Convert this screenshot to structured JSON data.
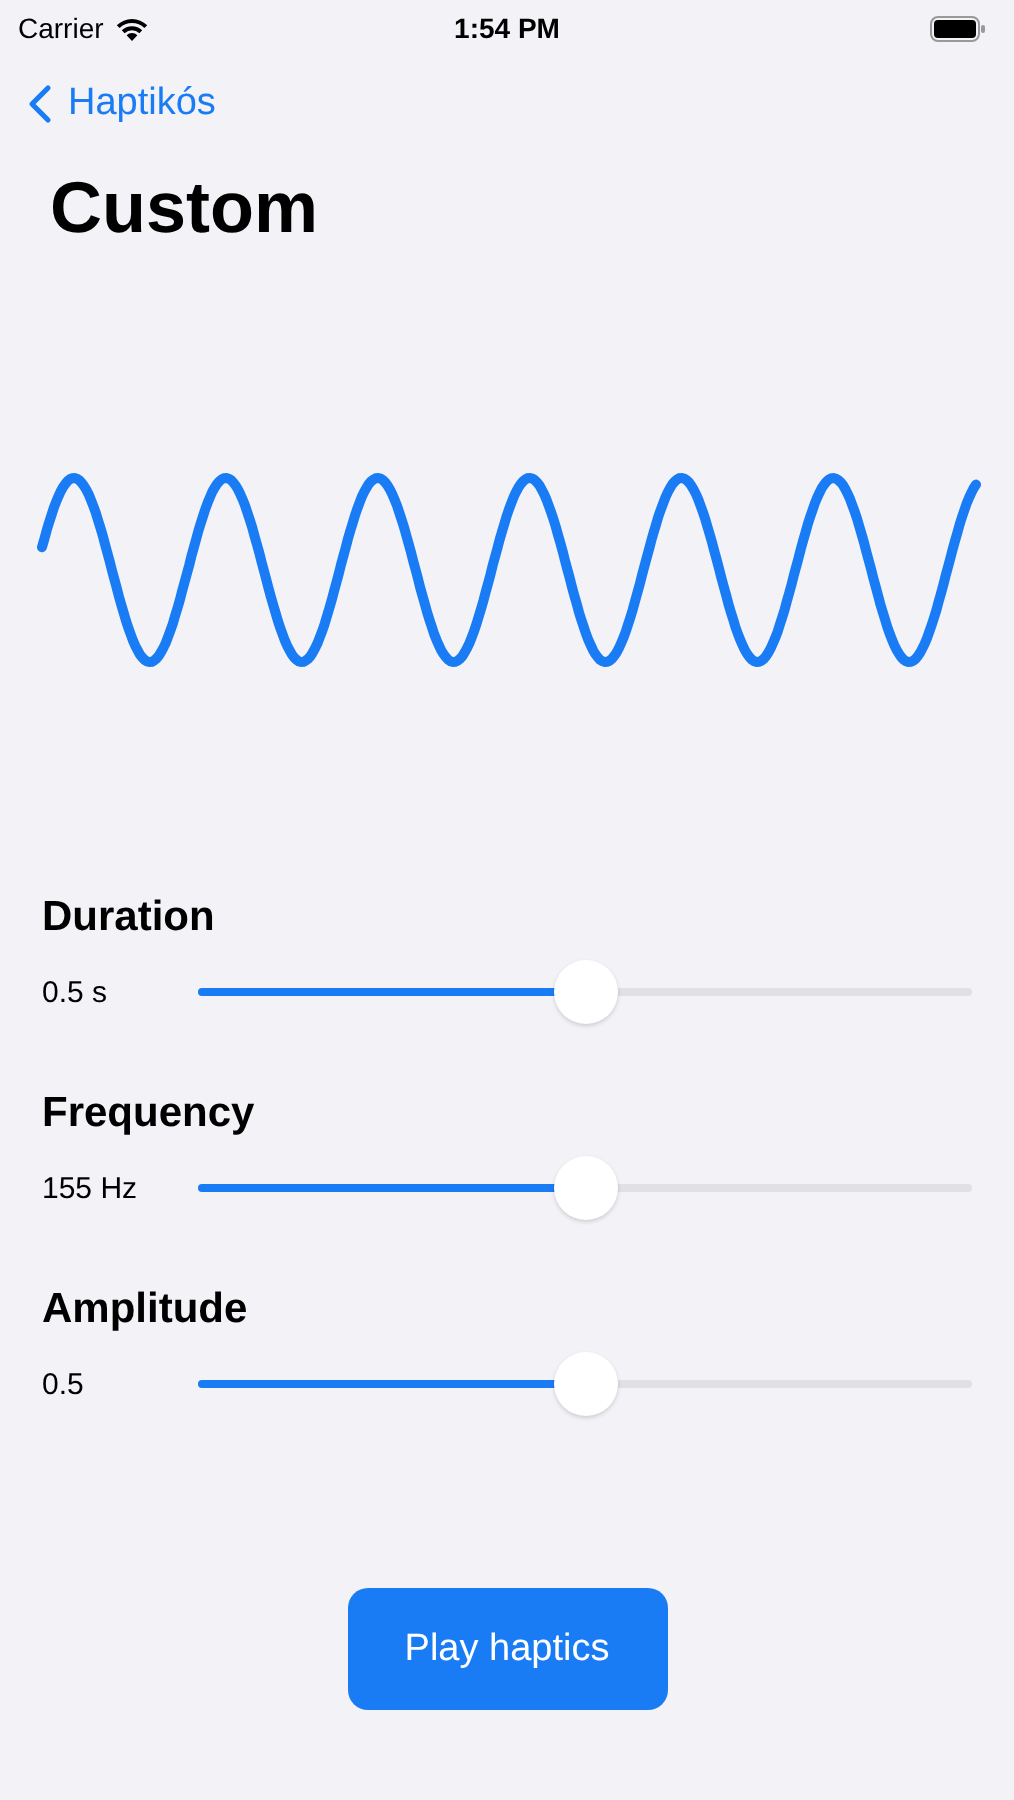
{
  "status_bar": {
    "carrier": "Carrier",
    "time": "1:54 PM"
  },
  "nav": {
    "back_label": "Haptikós"
  },
  "title": "Custom",
  "sliders": [
    {
      "name": "Duration",
      "reading": "0.5 s",
      "level": 0.5
    },
    {
      "name": "Frequency",
      "reading": "155 Hz",
      "level": 0.5
    },
    {
      "name": "Amplitude",
      "reading": "0.5",
      "level": 0.5
    }
  ],
  "button": "Play haptics"
}
